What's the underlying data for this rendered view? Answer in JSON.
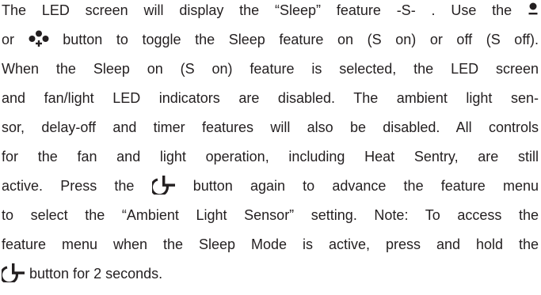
{
  "icons": {
    "minus_button": "minus-button-icon",
    "plus_button": "plus-button-icon",
    "power_button": "power-button-icon"
  },
  "paragraph": {
    "line1": "The LED screen will display the “Sleep” feature -S- .  Use the",
    "line2a": "or",
    "line2b": "button to toggle the Sleep feature on (S on) or off (S off).",
    "line3": "When the Sleep on (S on) feature is selected, the LED screen",
    "line4": "and fan/light LED indicators are disabled. The ambient light sen-",
    "line5": "sor, delay-off and timer features will also be disabled. All controls",
    "line6": "for the fan and light operation, including Heat Sentry, are still",
    "line7a": "active.  Press the",
    "line7b": "button again to advance the feature menu",
    "line8": "to select the “Ambient Light Sensor” setting. Note: To access the",
    "line9": "feature menu when the Sleep Mode is active, press and hold the",
    "line10": "button for 2 seconds."
  }
}
